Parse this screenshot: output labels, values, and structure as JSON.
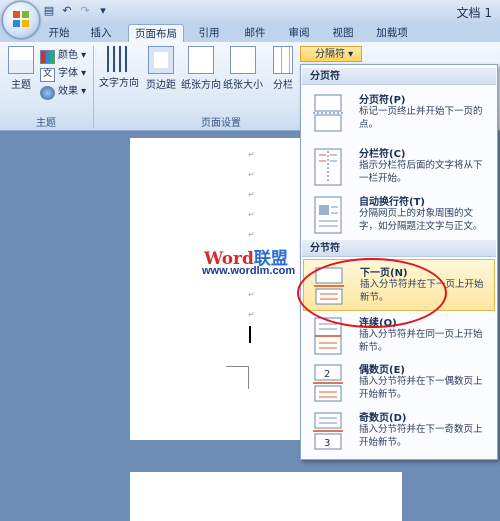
{
  "window": {
    "title": "文档 1"
  },
  "quick_access": {
    "icons": [
      "save-icon",
      "undo-icon",
      "redo-icon",
      "customize-icon"
    ]
  },
  "tabs": [
    {
      "label": "开始",
      "active": false
    },
    {
      "label": "插入",
      "active": false
    },
    {
      "label": "页面布局",
      "active": true
    },
    {
      "label": "引用",
      "active": false
    },
    {
      "label": "邮件",
      "active": false
    },
    {
      "label": "审阅",
      "active": false
    },
    {
      "label": "视图",
      "active": false
    },
    {
      "label": "加载项",
      "active": false
    }
  ],
  "ribbon": {
    "theme_group": {
      "label": "主题",
      "theme_button": "主题",
      "colors": "颜色",
      "fonts": "字体",
      "effects": "效果"
    },
    "page_setup_group": {
      "label": "页面设置",
      "buttons": [
        "文字方向",
        "页边距",
        "纸张方向",
        "纸张大小",
        "分栏"
      ],
      "breaks_button": "分隔符"
    }
  },
  "document": {
    "watermark_word": "Word",
    "watermark_cn": "联盟",
    "watermark_url": "www.wordlm.com",
    "paragraph_mark": "↵"
  },
  "breaks_menu": {
    "sections": [
      {
        "header": "分页符",
        "items": [
          {
            "title": "分页符(P)",
            "desc": "标记一页终止并开始下一页的点。",
            "icon": "page-break-icon"
          },
          {
            "title": "分栏符(C)",
            "desc": "指示分栏符后面的文字将从下一栏开始。",
            "icon": "column-break-icon"
          },
          {
            "title": "自动换行符(T)",
            "desc": "分隔网页上的对象周围的文字，如分隔题注文字与正文。",
            "icon": "text-wrapping-break-icon"
          }
        ]
      },
      {
        "header": "分节符",
        "items": [
          {
            "title": "下一页(N)",
            "desc": "插入分节符并在下一页上开始新节。",
            "icon": "next-page-break-icon",
            "highlighted": true
          },
          {
            "title": "连续(O)",
            "desc": "插入分节符并在同一页上开始新节。",
            "icon": "continuous-break-icon"
          },
          {
            "title": "偶数页(E)",
            "desc": "插入分节符并在下一偶数页上开始新节。",
            "icon": "even-page-break-icon",
            "badge": "2"
          },
          {
            "title": "奇数页(D)",
            "desc": "插入分节符并在下一奇数页上开始新节。",
            "icon": "odd-page-break-icon",
            "badge": "3"
          }
        ]
      }
    ]
  },
  "colors": {
    "highlight_ellipse": "#e0161c",
    "menu_highlight": "#ffe7a0"
  }
}
